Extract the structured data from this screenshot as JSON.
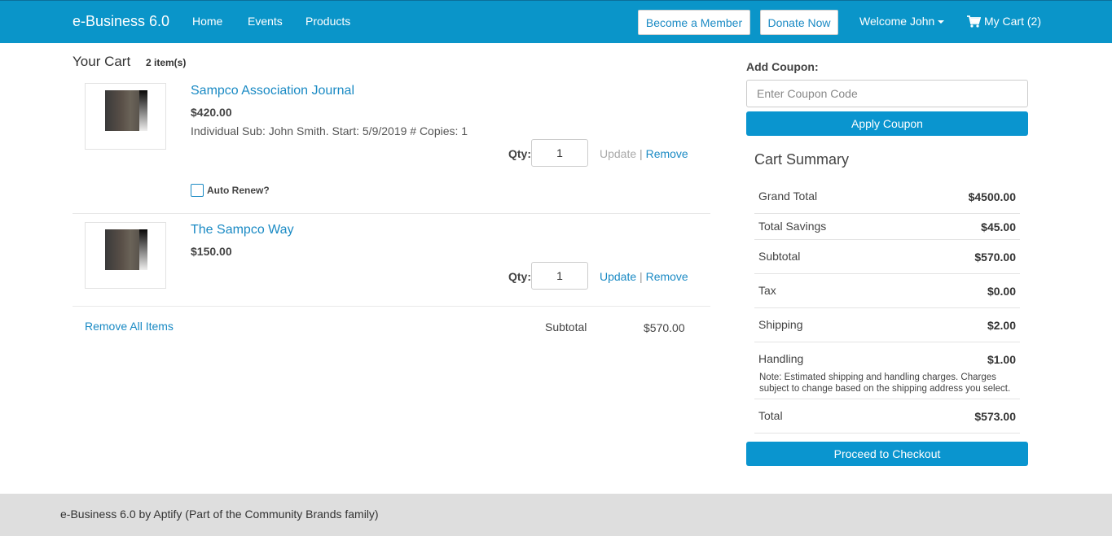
{
  "nav": {
    "brand": "e-Business 6.0",
    "links": [
      "Home",
      "Events",
      "Products"
    ],
    "become_member": "Become a Member",
    "donate_now": "Donate Now",
    "welcome": "Welcome John",
    "cart": "My Cart (2)"
  },
  "cart": {
    "title": "Your Cart",
    "count": "2 item(s)",
    "items": [
      {
        "name": "Sampco Association Journal",
        "price": "$420.00",
        "description": "Individual Sub: John Smith. Start: 5/9/2019 # Copies: 1",
        "qty_label": "Qty:",
        "qty": "1",
        "update": "Update",
        "remove": "Remove",
        "auto_renew": "Auto Renew?"
      },
      {
        "name": "The Sampco Way",
        "price": "$150.00",
        "qty_label": "Qty:",
        "qty": "1",
        "update": "Update",
        "remove": "Remove"
      }
    ],
    "remove_all": "Remove All Items",
    "subtotal_label": "Subtotal",
    "subtotal_value": "$570.00"
  },
  "coupon": {
    "label": "Add Coupon:",
    "placeholder": "Enter Coupon Code",
    "apply": "Apply Coupon"
  },
  "summary": {
    "title": "Cart Summary",
    "rows": [
      {
        "label": "Grand Total",
        "value": "$4500.00"
      },
      {
        "label": "Total Savings",
        "value": "$45.00"
      },
      {
        "label": "Subtotal",
        "value": "$570.00"
      },
      {
        "label": "Tax",
        "value": "$0.00"
      },
      {
        "label": "Shipping",
        "value": "$2.00"
      },
      {
        "label": "Handling",
        "value": "$1.00"
      },
      {
        "label": "Total",
        "value": "$573.00"
      }
    ],
    "note": "Note: Estimated shipping and handling charges. Charges subject to change based on the shipping address you select.",
    "checkout": "Proceed to Checkout"
  },
  "footer": {
    "text": "e-Business 6.0 by Aptify (Part of the Community Brands family)"
  },
  "colors": {
    "nav_bg": "#0a95c9",
    "link": "#1a8ac4",
    "button": "#0a95cf",
    "footer_bg": "#dedede"
  },
  "icons": [
    "caret-down-icon",
    "shopping-cart-icon"
  ]
}
